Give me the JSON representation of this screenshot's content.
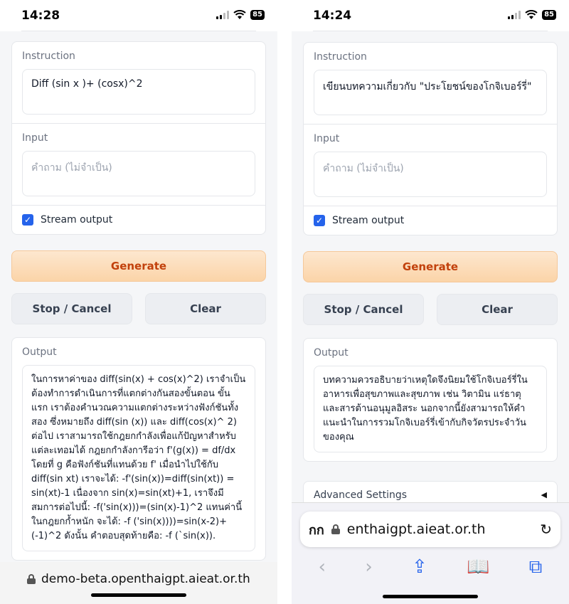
{
  "left": {
    "time": "14:28",
    "battery": "85",
    "instruction_label": "Instruction",
    "instruction_value": "Diff (sin x )+ (cosx)^2",
    "input_label": "Input",
    "input_placeholder": "คำถาม (ไม่จำเป็น)",
    "stream_label": "Stream output",
    "generate_label": "Generate",
    "stop_label": "Stop / Cancel",
    "clear_label": "Clear",
    "output_label": "Output",
    "output_text": "ในการหาค่าของ diff(sin(x) + cos(x)^2) เราจำเป็นต้องทำการดำเนินการที่แตกต่างกันสองขั้นตอน ขั้นแรก เราต้องคำนวณความแตกต่างระหว่างฟังก์ชันทั้งสอง ซึ่งหมายถึง diff(sin (x)) และ diff(cos(x)^ 2) ต่อไป เราสามารถใช้กฎยกกำลังเพื่อแก้ปัญหาสำหรับแต่ละเทอมได้ กฎยกกำลังการีอว่า f'(g(x)) = df/dx โดยที่ g คือฟังก์ชันที่แทนด้วย f' เมื่อนำไปใช้กับ diff(sin xt) เราจะได้: -f'(sin(x))=diff(sin(xt)) = sin(xt)-1 เนื่องจาก sin(x)=sin(xt)+1, เราจึงมีสมการต่อไปนี้: -f('sin(x)))=(sin(x)-1)^2 แทนค่านี้ในกฎยกก้ำหนัก จะได้: -f ('sin(x))))=sin(x-2)+(-1)^2 ดังนั้น คำตอบสุดท้ายคือ: -f (`sin(x)).",
    "url": "demo-beta.openthaigpt.aieat.or.th"
  },
  "right": {
    "time": "14:24",
    "battery": "85",
    "instruction_label": "Instruction",
    "instruction_value": "เขียนบทความเกี่ยวกับ \"ประโยชน์ของโกจิเบอร์รี่\"",
    "input_label": "Input",
    "input_placeholder": "คำถาม (ไม่จำเป็น)",
    "stream_label": "Stream output",
    "generate_label": "Generate",
    "stop_label": "Stop / Cancel",
    "clear_label": "Clear",
    "output_label": "Output",
    "output_text": "บทความควรอธิบายว่าเหตุใดจึงนิยมใช้โกจิเบอร์รี่ในอาหารเพื่อสุขภาพและสุขภาพ เช่น วิตามิน แร่ธาตุ และสารต้านอนุมูลอิสระ นอกจากนี้ยังสามารถให้คำแนะนำในการรวมโกจิเบอร์รี่เข้ากับกิจวัตรประจำวันของคุณ",
    "advanced_label": "Advanced Settings",
    "aa_label": "กก",
    "url": "enthaigpt.aieat.or.th"
  },
  "colors": {
    "accent": "#2563eb",
    "generate_text": "#c2410c"
  }
}
